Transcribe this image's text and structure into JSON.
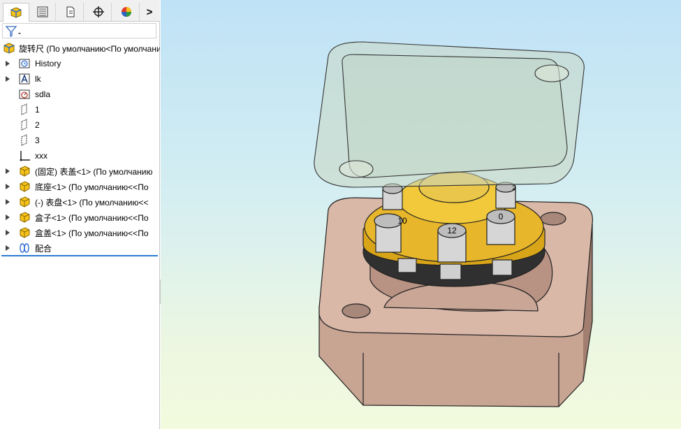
{
  "feature_tree": {
    "tabs": [
      "feature-manager-tab",
      "property-manager-tab",
      "configuration-manager-tab",
      "dimxpert-manager-tab",
      "display-manager-tab"
    ],
    "expand_glyph": ">",
    "root": "旋转尺  (По умолчанию<По умолчанию",
    "items": [
      {
        "label": "History",
        "icon": "history-icon"
      },
      {
        "label": "lk",
        "icon": "annotations-icon"
      },
      {
        "label": "sdla",
        "icon": "sensor-icon"
      },
      {
        "label": "1",
        "icon": "plane-icon"
      },
      {
        "label": "2",
        "icon": "plane-icon"
      },
      {
        "label": "3",
        "icon": "plane-icon"
      },
      {
        "label": "xxx",
        "icon": "origin-icon"
      },
      {
        "label": "(固定) 表盖<1> (По умолчанию",
        "icon": "part-icon"
      },
      {
        "label": "底座<1> (По умолчанию<<По",
        "icon": "part-icon"
      },
      {
        "label": "(-) 表盘<1> (По умолчанию<<",
        "icon": "part-icon"
      },
      {
        "label": "盒子<1> (По умолчанию<<По",
        "icon": "part-icon"
      },
      {
        "label": "盒盖<1> (По умолчанию<<По",
        "icon": "part-icon"
      },
      {
        "label": "配合",
        "icon": "mates-icon"
      }
    ]
  },
  "model": {
    "dial_labels": [
      "10",
      "12",
      "0",
      "2"
    ]
  },
  "colors": {
    "accent": "#2c7bd4",
    "gold": "#d8a418",
    "box": "#c8a493"
  }
}
